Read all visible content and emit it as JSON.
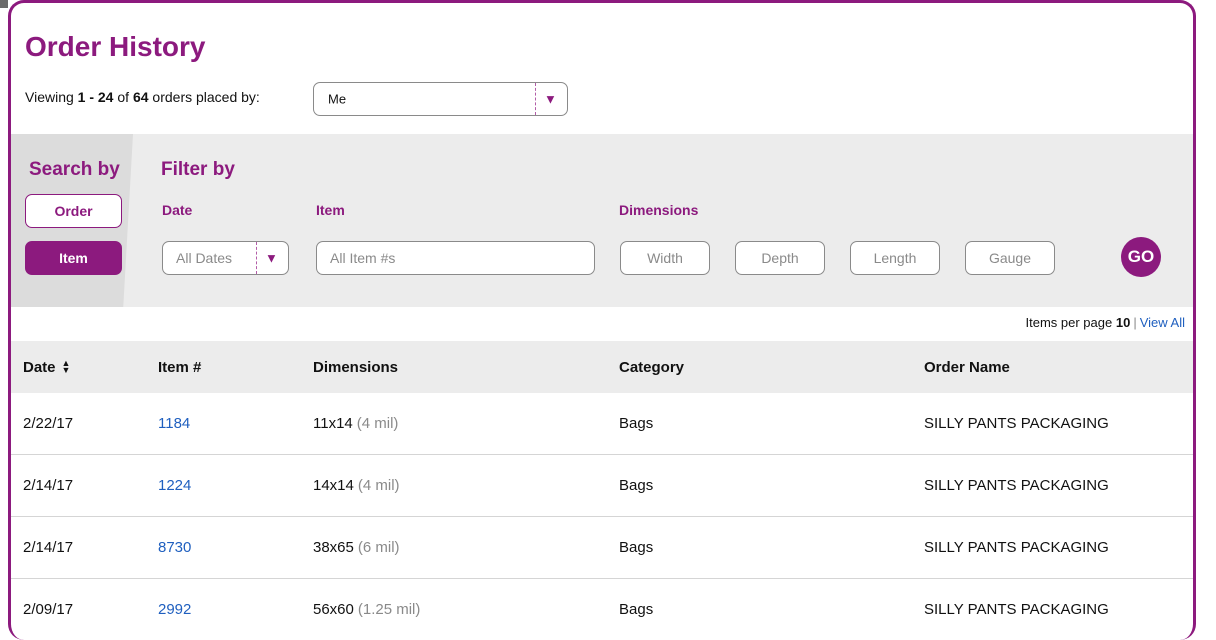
{
  "page": {
    "title": "Order History"
  },
  "viewing": {
    "prefix": "Viewing",
    "range": "1 - 24",
    "of": "of",
    "total": "64",
    "suffix": "orders placed by:",
    "placed_by": "Me"
  },
  "search": {
    "title": "Search by",
    "order_label": "Order",
    "item_label": "Item",
    "active": "Item"
  },
  "filter": {
    "title": "Filter by",
    "date_label": "Date",
    "date_value": "All Dates",
    "item_label": "Item",
    "item_placeholder": "All Item #s",
    "dimensions_label": "Dimensions",
    "width_placeholder": "Width",
    "depth_placeholder": "Depth",
    "length_placeholder": "Length",
    "gauge_placeholder": "Gauge",
    "go_label": "GO"
  },
  "pagination": {
    "items_per_page_label": "Items per page",
    "items_per_page": "10",
    "view_all": "View All"
  },
  "table": {
    "columns": [
      "Date",
      "Item #",
      "Dimensions",
      "Category",
      "Order Name"
    ],
    "rows": [
      {
        "date": "2/22/17",
        "item": "1184",
        "dim": "11x14",
        "mil": "(4 mil)",
        "category": "Bags",
        "name": "SILLY PANTS PACKAGING"
      },
      {
        "date": "2/14/17",
        "item": "1224",
        "dim": "14x14",
        "mil": "(4 mil)",
        "category": "Bags",
        "name": "SILLY PANTS PACKAGING"
      },
      {
        "date": "2/14/17",
        "item": "8730",
        "dim": "38x65",
        "mil": "(6 mil)",
        "category": "Bags",
        "name": "SILLY PANTS PACKAGING"
      },
      {
        "date": "2/09/17",
        "item": "2992",
        "dim": "56x60",
        "mil": "(1.25 mil)",
        "category": "Bags",
        "name": "SILLY PANTS PACKAGING"
      }
    ]
  },
  "colors": {
    "brand": "#8c1a7e",
    "link": "#1f5fbf",
    "band": "#ececec"
  },
  "icons": {
    "dropdown": "triangle-down-icon",
    "sort": "sort-updown-icon"
  }
}
